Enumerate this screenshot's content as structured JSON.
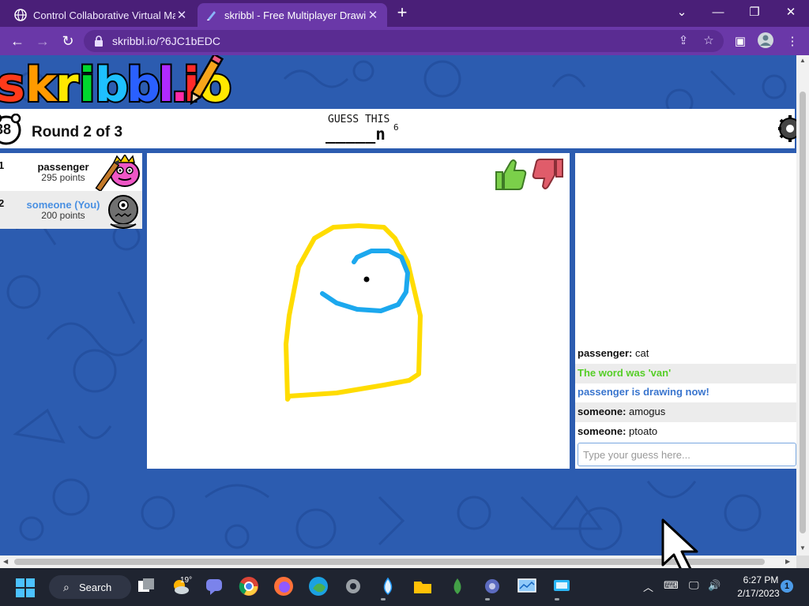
{
  "browser": {
    "tabs": [
      {
        "title": "Control Collaborative Virtual Mac",
        "active": false
      },
      {
        "title": "skribbl - Free Multiplayer Drawing",
        "active": true
      }
    ],
    "url": "skribbl.io/?6JC1bEDC"
  },
  "game": {
    "logo_text": "skribbl.io",
    "timer": "38",
    "round": "Round 2 of 3",
    "guess_label": "GUESS THIS",
    "hint": "_____n",
    "hint_letter_count": "6"
  },
  "players": [
    {
      "rank": "1",
      "name": "passenger",
      "points": "295 points",
      "drawing": true
    },
    {
      "rank": "2",
      "name": "someone (You)",
      "points": "200 points",
      "drawing": false
    }
  ],
  "chat": {
    "messages": [
      {
        "author": "passenger:",
        "text": " cat"
      },
      {
        "text": "The word was 'van'"
      },
      {
        "text": "passenger is drawing now!"
      },
      {
        "author": "someone:",
        "text": " amogus"
      },
      {
        "author": "someone:",
        "text": " ptoato"
      }
    ],
    "input_placeholder": "Type your guess here..."
  },
  "taskbar": {
    "search_label": "Search",
    "weather_temp": "19°",
    "time": "6:27 PM",
    "date": "2/17/2023",
    "notification_count": "1"
  },
  "colors": {
    "browser_frame": "#4a1f78",
    "browser_toolbar": "#6a38a8",
    "page_background": "#2c5cb0",
    "stroke_yellow": "#ffdc00",
    "stroke_blue": "#1ca8ee",
    "chat_green": "#56ce27",
    "chat_blue": "#3975ce"
  }
}
